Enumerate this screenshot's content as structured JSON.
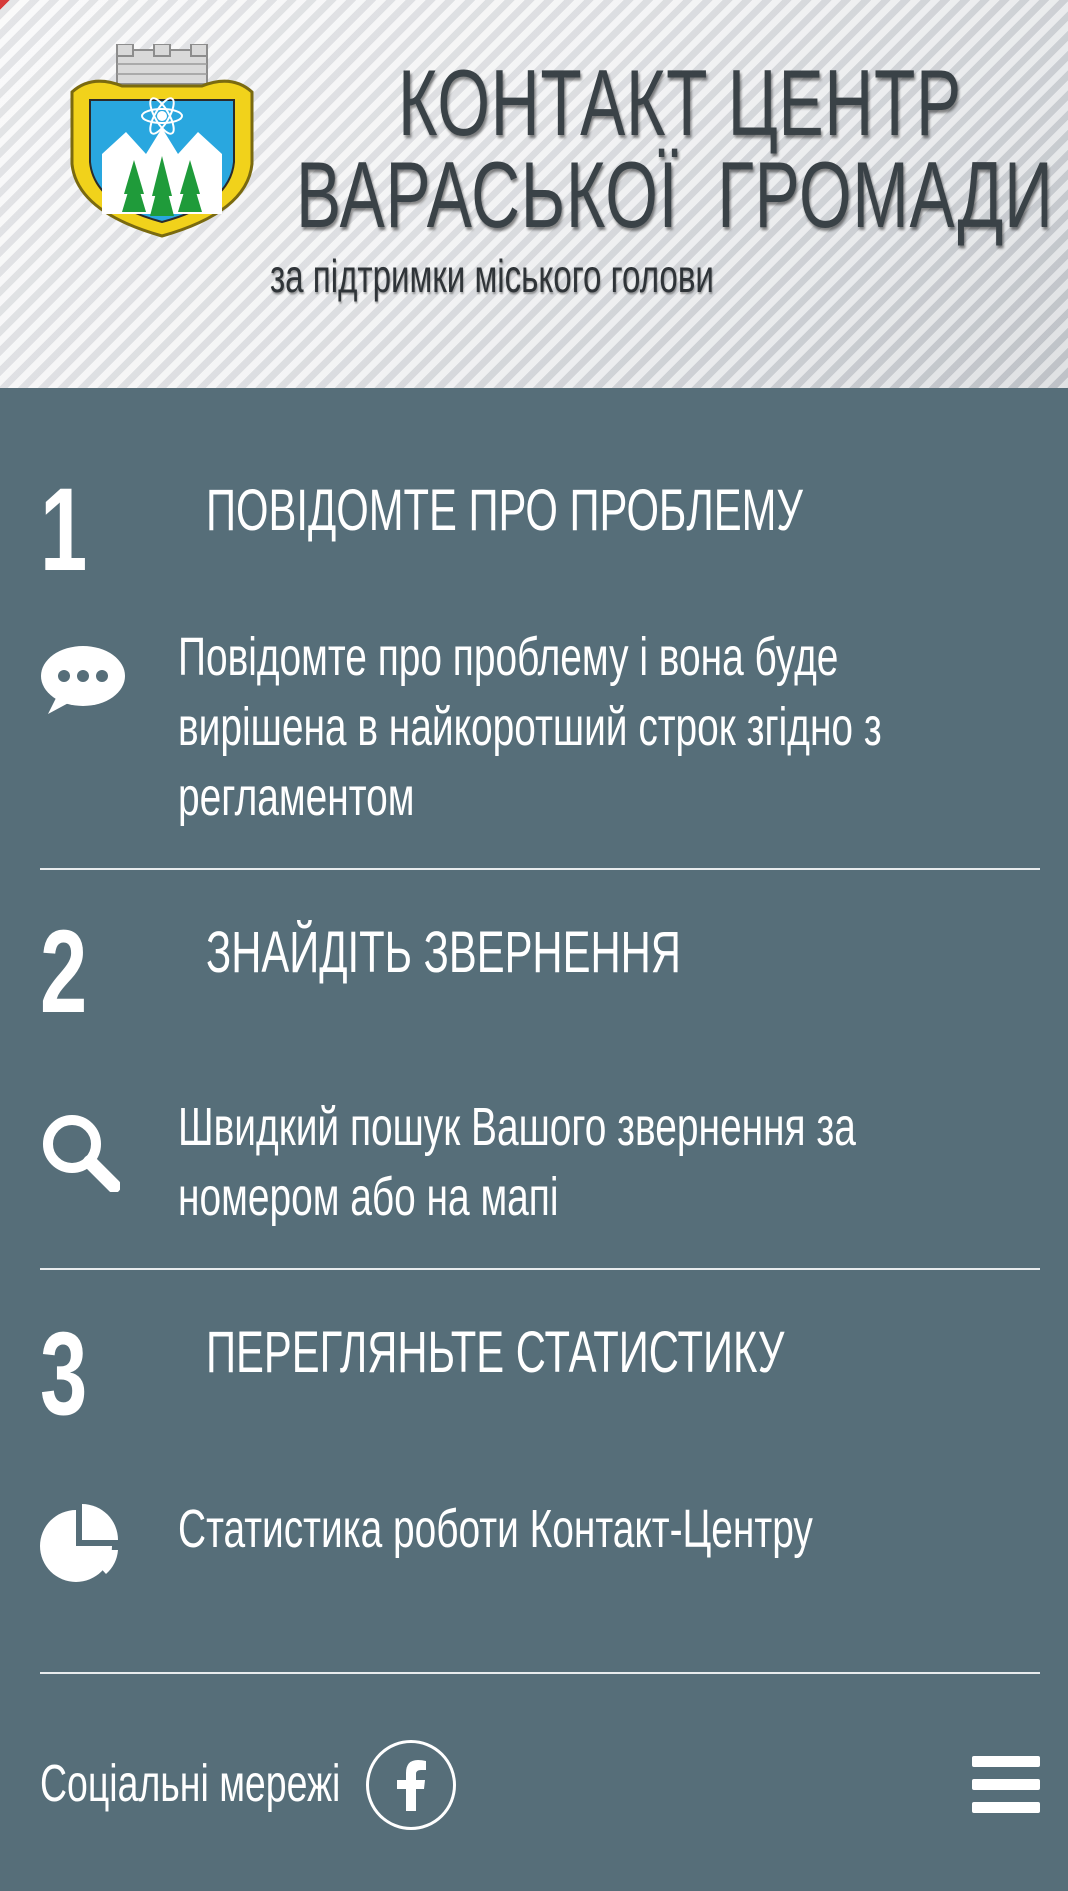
{
  "header": {
    "title_line1": "КОНТАКТ ЦЕНТР",
    "title_line2": "ВАРАСЬКОЇ  ГРОМАДИ",
    "subtitle": "за підтримки міського голови"
  },
  "steps": [
    {
      "number": "1",
      "title": "ПОВІДОМТЕ ПРО ПРОБЛЕМУ",
      "description": "Повідомте про проблему і вона буде вирішена в найкоротший строк згідно з регламентом",
      "icon": "chat-bubble-icon"
    },
    {
      "number": "2",
      "title": "ЗНАЙДІТЬ ЗВЕРНЕННЯ",
      "description": "Швидкий пошук Вашого звернення за номером або на мапі",
      "icon": "search-icon"
    },
    {
      "number": "3",
      "title": "ПЕРЕГЛЯНЬТЕ СТАТИСТИКУ",
      "description": "Статистика роботи Контакт-Центру",
      "icon": "pie-chart-icon"
    }
  ],
  "footer": {
    "social_label": "Соціальні мережі",
    "facebook_icon": "facebook-icon",
    "menu_icon": "hamburger-menu-icon"
  },
  "colors": {
    "background": "#566e79",
    "text": "#ffffff",
    "title": "#3a4247"
  }
}
